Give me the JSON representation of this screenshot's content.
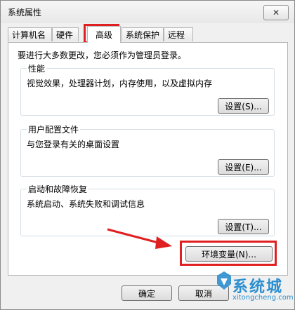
{
  "window": {
    "title": "系统属性",
    "close_glyph": "✕"
  },
  "tabs": [
    {
      "label": "计算机名"
    },
    {
      "label": "硬件"
    },
    {
      "label": "高级"
    },
    {
      "label": "系统保护"
    },
    {
      "label": "远程"
    }
  ],
  "note": "要进行大多数更改，您必须作为管理员登录。",
  "groups": {
    "performance": {
      "title": "性能",
      "desc": "视觉效果，处理器计划，内存使用，以及虚拟内存",
      "button": "设置(S)..."
    },
    "profiles": {
      "title": "用户配置文件",
      "desc": "与您登录有关的桌面设置",
      "button": "设置(E)..."
    },
    "startup": {
      "title": "启动和故障恢复",
      "desc": "系统启动、系统失败和调试信息",
      "button": "设置(T)..."
    }
  },
  "env_button": "环境变量(N)...",
  "footer": {
    "ok": "确定",
    "cancel": "取消"
  },
  "highlight_color": "#e02020",
  "watermark": {
    "name": "系统城",
    "url": "xitongcheng.com",
    "color": "#2c8fcf"
  }
}
